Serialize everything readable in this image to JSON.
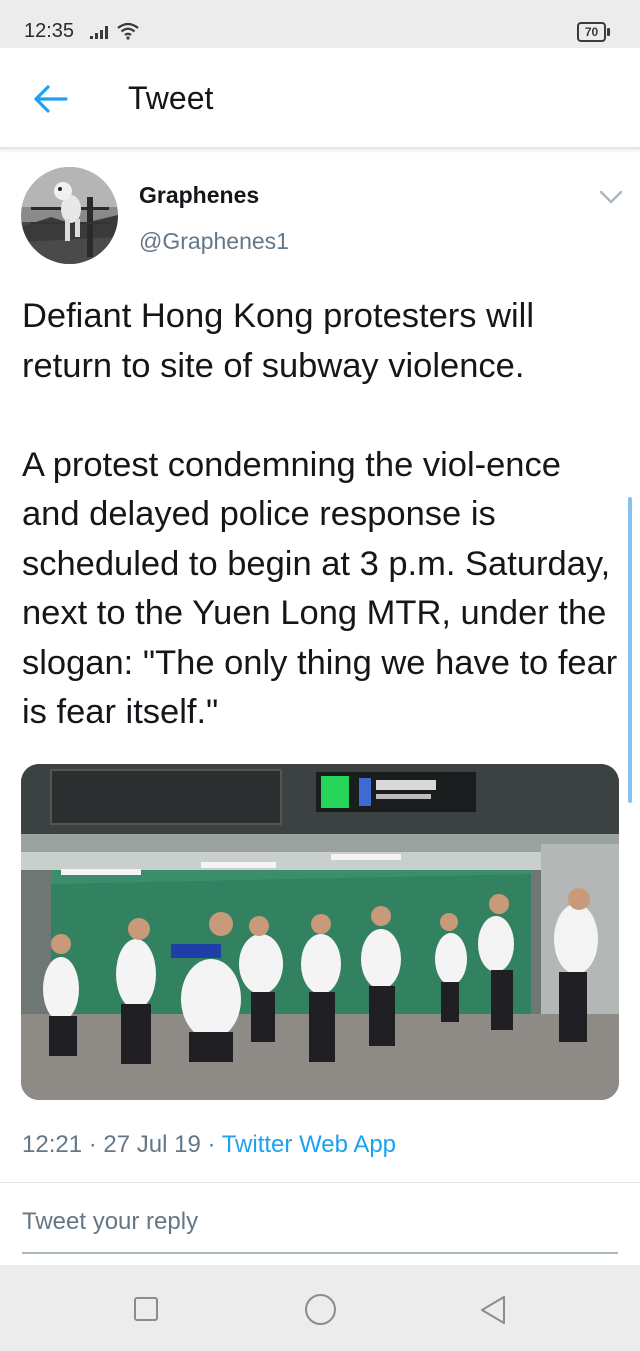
{
  "status_bar": {
    "time": "12:35",
    "battery": "70",
    "icons": [
      "signal-icon",
      "wifi-icon",
      "battery-icon"
    ]
  },
  "header": {
    "title": "Tweet",
    "back_icon": "arrow-left-icon"
  },
  "tweet": {
    "author_name": "Graphenes",
    "author_handle": "@Graphenes1",
    "text_paragraphs": [
      "Defiant Hong Kong protesters will return to site of subway violence.",
      "A protest condemning the viol-ence and delayed police response is scheduled to begin at 3 p.m. Saturday, next to the Yuen Long MTR, under the slogan: \"The only thing we have to fear is fear itself.\""
    ],
    "time": "12:21",
    "date": "27 Jul 19",
    "source": "Twitter Web App",
    "separator": "·"
  },
  "reply": {
    "placeholder": "Tweet your reply"
  },
  "nav_bar": {
    "icons": [
      "recent-apps-icon",
      "home-icon",
      "back-triangle-icon"
    ]
  },
  "colors": {
    "accent": "#1da1f2",
    "secondary_text": "#657786",
    "primary_text": "#14171a",
    "system_bar": "#ececec"
  }
}
